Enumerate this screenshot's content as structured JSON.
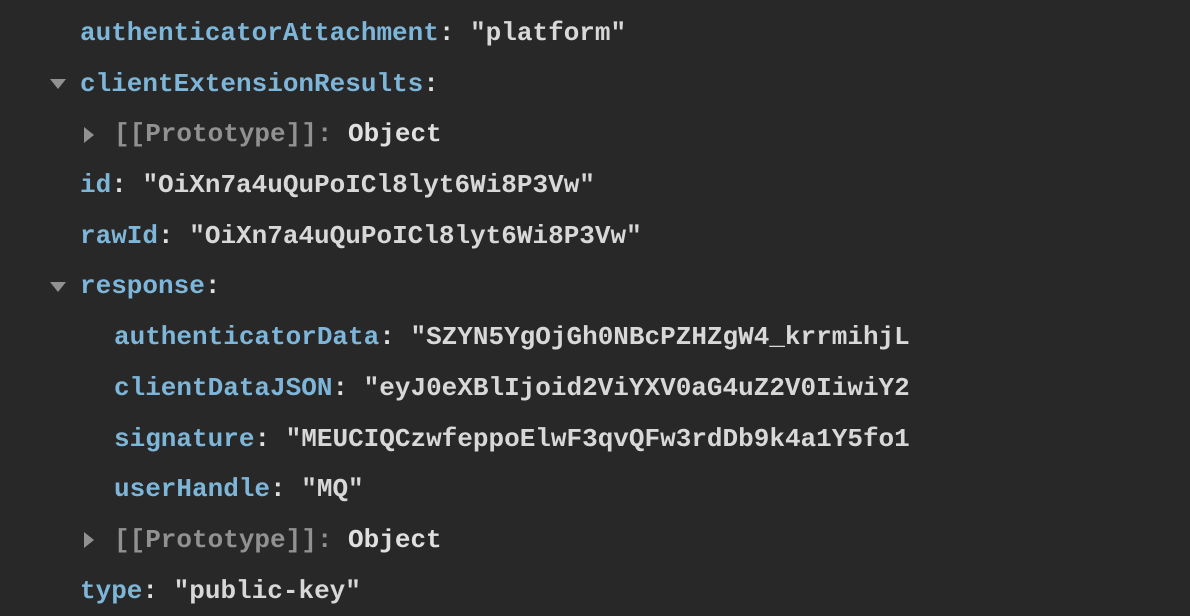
{
  "rows": [
    {
      "indent": 0,
      "arrow": null,
      "segments": [
        {
          "cls": "key",
          "text": "authenticatorAttachment"
        },
        {
          "cls": "obj",
          "text": ": "
        },
        {
          "cls": "str",
          "text": "\"platform\""
        }
      ]
    },
    {
      "indent": 0,
      "arrow": "down",
      "segments": [
        {
          "cls": "key",
          "text": "clientExtensionResults"
        },
        {
          "cls": "obj",
          "text": ":"
        }
      ]
    },
    {
      "indent": 1,
      "arrow": "right",
      "segments": [
        {
          "cls": "muted",
          "text": "[[Prototype]]: "
        },
        {
          "cls": "obj",
          "text": "Object"
        }
      ]
    },
    {
      "indent": 0,
      "arrow": null,
      "segments": [
        {
          "cls": "key",
          "text": "id"
        },
        {
          "cls": "obj",
          "text": ": "
        },
        {
          "cls": "str",
          "text": "\"OiXn7a4uQuPoICl8lyt6Wi8P3Vw\""
        }
      ]
    },
    {
      "indent": 0,
      "arrow": null,
      "segments": [
        {
          "cls": "key",
          "text": "rawId"
        },
        {
          "cls": "obj",
          "text": ": "
        },
        {
          "cls": "str",
          "text": "\"OiXn7a4uQuPoICl8lyt6Wi8P3Vw\""
        }
      ]
    },
    {
      "indent": 0,
      "arrow": "down",
      "segments": [
        {
          "cls": "key",
          "text": "response"
        },
        {
          "cls": "obj",
          "text": ":"
        }
      ]
    },
    {
      "indent": 1,
      "arrow": null,
      "segments": [
        {
          "cls": "key",
          "text": "authenticatorData"
        },
        {
          "cls": "obj",
          "text": ": "
        },
        {
          "cls": "str",
          "text": "\"SZYN5YgOjGh0NBcPZHZgW4_krrmihjL"
        }
      ]
    },
    {
      "indent": 1,
      "arrow": null,
      "segments": [
        {
          "cls": "key",
          "text": "clientDataJSON"
        },
        {
          "cls": "obj",
          "text": ": "
        },
        {
          "cls": "str",
          "text": "\"eyJ0eXBlIjoid2ViYXV0aG4uZ2V0IiwiY2"
        }
      ]
    },
    {
      "indent": 1,
      "arrow": null,
      "segments": [
        {
          "cls": "key",
          "text": "signature"
        },
        {
          "cls": "obj",
          "text": ": "
        },
        {
          "cls": "str",
          "text": "\"MEUCIQCzwfeppoElwF3qvQFw3rdDb9k4a1Y5fo1"
        }
      ]
    },
    {
      "indent": 1,
      "arrow": null,
      "segments": [
        {
          "cls": "key",
          "text": "userHandle"
        },
        {
          "cls": "obj",
          "text": ": "
        },
        {
          "cls": "str",
          "text": "\"MQ\""
        }
      ]
    },
    {
      "indent": 1,
      "arrow": "right",
      "segments": [
        {
          "cls": "muted",
          "text": "[[Prototype]]: "
        },
        {
          "cls": "obj",
          "text": "Object"
        }
      ]
    },
    {
      "indent": 0,
      "arrow": null,
      "segments": [
        {
          "cls": "key",
          "text": "type"
        },
        {
          "cls": "obj",
          "text": ": "
        },
        {
          "cls": "str",
          "text": "\"public-key\""
        }
      ]
    }
  ]
}
